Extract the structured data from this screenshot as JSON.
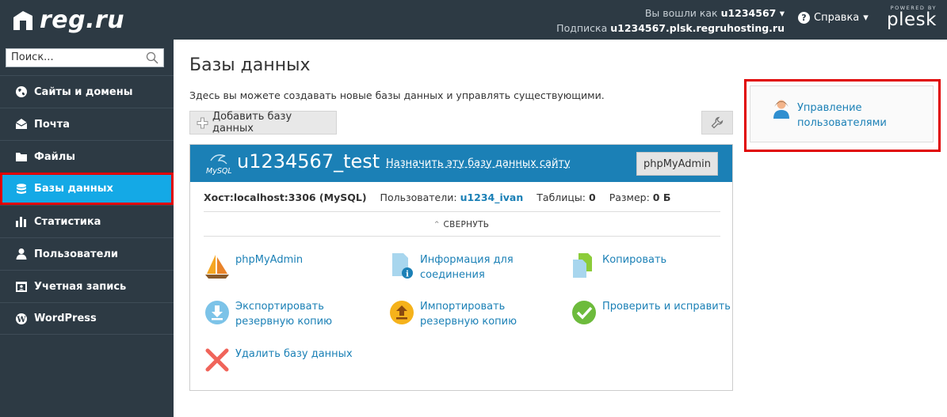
{
  "header": {
    "logo_text": "reg.ru",
    "logged_in_label": "Вы вошли как",
    "username": "u1234567",
    "subscription_label": "Подписка",
    "subscription_value": "u1234567.plsk.regruhosting.ru",
    "help_label": "Справка",
    "powered_by": "POWERED BY",
    "plesk": "plesk"
  },
  "sidebar": {
    "search_placeholder": "Поиск...",
    "items": [
      {
        "label": "Сайты и домены",
        "icon": "globe-icon"
      },
      {
        "label": "Почта",
        "icon": "mail-icon"
      },
      {
        "label": "Файлы",
        "icon": "folder-icon"
      },
      {
        "label": "Базы данных",
        "icon": "database-icon",
        "active": true
      },
      {
        "label": "Статистика",
        "icon": "bar-chart-icon"
      },
      {
        "label": "Пользователи",
        "icon": "user-icon"
      },
      {
        "label": "Учетная запись",
        "icon": "account-icon"
      },
      {
        "label": "WordPress",
        "icon": "wordpress-icon"
      }
    ]
  },
  "main": {
    "title": "Базы данных",
    "description": "Здесь вы можете создавать новые базы данных и управлять существующими.",
    "add_button": "Добавить базу данных",
    "db": {
      "name": "u1234567_test",
      "mysql_label": "MySQL",
      "assign_link": "Назначить эту базу данных сайту",
      "pma_button": "phpMyAdmin",
      "host_label": "Хост:",
      "host_value": "localhost:3306 (MySQL)",
      "users_label": "Пользователи:",
      "users_value": "u1234_ivan",
      "tables_label": "Таблицы:",
      "tables_value": "0",
      "size_label": "Размер:",
      "size_value": "0 Б",
      "collapse": "СВЕРНУТЬ",
      "actions": {
        "phpmyadmin": "phpMyAdmin",
        "connection_info_1": "Информация для",
        "connection_info_2": "соединения",
        "copy": "Копировать",
        "export_1": "Экспортировать",
        "export_2": "резервную копию",
        "import_1": "Импортировать",
        "import_2": "резервную копию",
        "check_repair": "Проверить и исправить",
        "delete": "Удалить базу данных"
      }
    }
  },
  "right_panel": {
    "user_mgmt_1": "Управление",
    "user_mgmt_2": "пользователями"
  },
  "colors": {
    "header_bg": "#2d3a44",
    "accent": "#14a9e6",
    "db_header": "#1b80b6",
    "highlight": "#e00000"
  }
}
